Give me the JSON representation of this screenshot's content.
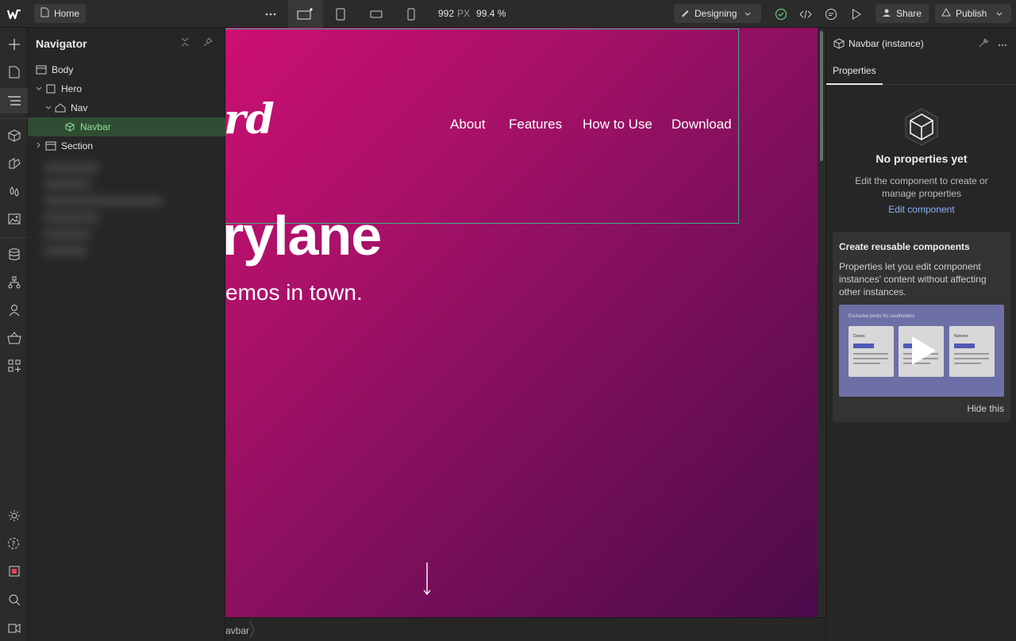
{
  "topbar": {
    "home_label": "Home",
    "width_value": "992",
    "width_unit": "PX",
    "zoom": "99.4 %",
    "mode_label": "Designing",
    "share_label": "Share",
    "publish_label": "Publish"
  },
  "navigator": {
    "title": "Navigator",
    "items": [
      {
        "label": "Body",
        "icon": "body-icon"
      },
      {
        "label": "Hero",
        "icon": "section-icon"
      },
      {
        "label": "Nav",
        "icon": "nav-home-icon"
      },
      {
        "label": "Navbar",
        "icon": "component-icon",
        "selected": true
      },
      {
        "label": "Section",
        "icon": "section-icon"
      }
    ]
  },
  "canvas": {
    "logo_text": "rd",
    "nav_links": [
      "About",
      "Features",
      "How to Use",
      "Download"
    ],
    "hero_title": "rylane",
    "hero_subtitle": "emos in town."
  },
  "breadcrumb": {
    "current": "avbar"
  },
  "right_panel": {
    "title": "Navbar (instance)",
    "tab": "Properties",
    "empty_title": "No properties yet",
    "empty_desc": "Edit the component to create or manage properties",
    "edit_link": "Edit component",
    "promo_title": "Create reusable components",
    "promo_desc": "Properties let you edit component instances' content without affecting other instances.",
    "promo_video_caption": "Exclusive perks for cardholders",
    "promo_cards": [
      "Deeps",
      "",
      "Nuhstre"
    ],
    "hide_label": "Hide this"
  },
  "colors": {
    "selection_green": "#3fae8a",
    "link_blue": "#8ab4f8",
    "canvas_gradient_start": "#cc0f72",
    "canvas_gradient_end": "#4a0b4b"
  }
}
